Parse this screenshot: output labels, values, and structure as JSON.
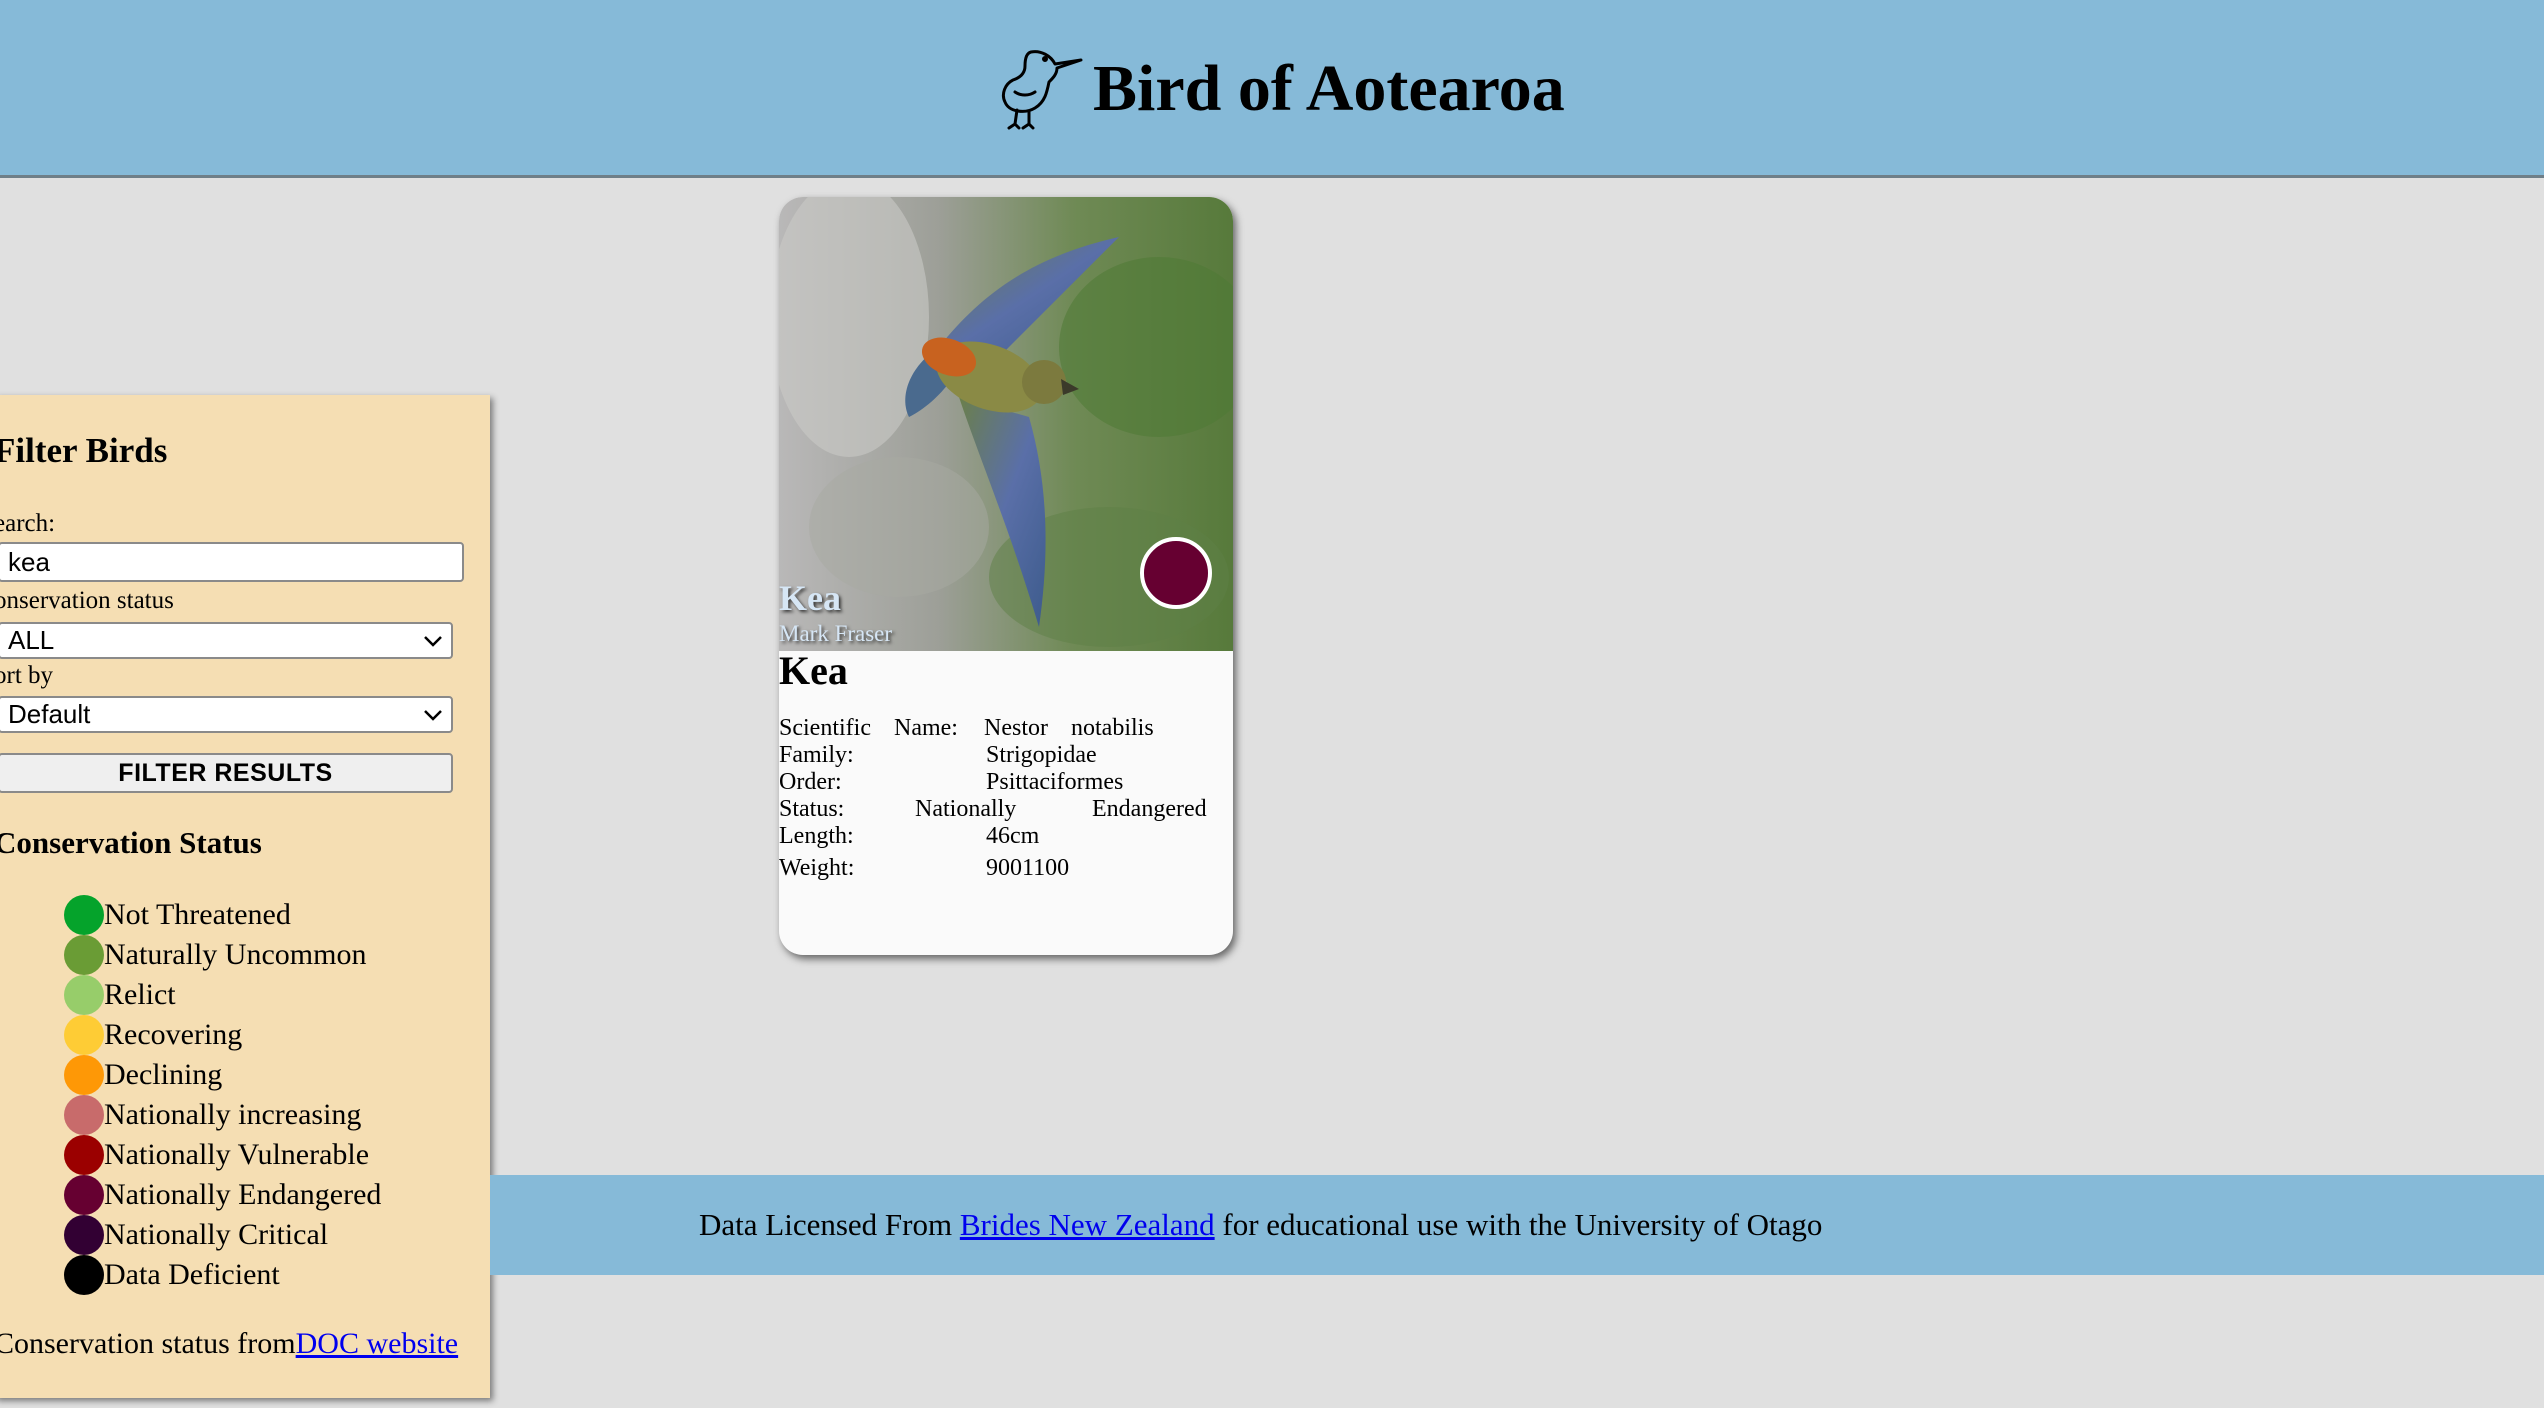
{
  "header": {
    "title": "Bird of Aotearoa",
    "logo_icon": "kiwi-bird-icon"
  },
  "sidebar": {
    "heading": "Filter Birds",
    "search_label": "earch:",
    "search_value": "kea",
    "status_label": "onservation status",
    "status_selected": "ALL",
    "sort_label": "ort by",
    "sort_selected": "Default",
    "filter_button": "FILTER RESULTS",
    "legend_heading": "Conservation Status",
    "legend": [
      {
        "label": "Not Threatened",
        "color": "#05a32b"
      },
      {
        "label": "Naturally Uncommon",
        "color": "#6a9c35"
      },
      {
        "label": "Relict",
        "color": "#97cd6a"
      },
      {
        "label": "Recovering",
        "color": "#fecc35"
      },
      {
        "label": "Declining",
        "color": "#fe9806"
      },
      {
        "label": "Nationally increasing",
        "color": "#c86b6b"
      },
      {
        "label": "Nationally Vulnerable",
        "color": "#9b0000"
      },
      {
        "label": "Nationally Endangered",
        "color": "#660031"
      },
      {
        "label": "Nationally Critical",
        "color": "#320033"
      },
      {
        "label": "Data Deficient",
        "color": "#000000"
      }
    ],
    "source_prefix": "Conservation status from",
    "source_link": "DOC website"
  },
  "card": {
    "photo_name": "Kea",
    "photo_credit": "Mark Fraser",
    "status_color": "#660031",
    "title": "Kea",
    "details": {
      "scientific_a": "Scientific",
      "scientific_b": "Name:",
      "scientific_c": "Nestor",
      "scientific_d": "notabilis",
      "family_label": "Family:",
      "family_value": "Strigopidae",
      "order_label": "Order:",
      "order_value": "Psittaciformes",
      "status_label": "Status:",
      "status_a": "Nationally",
      "status_b": "Endangered",
      "length_label": "Length:",
      "length_value": "46cm",
      "weight_label": "Weight:",
      "weight_value": "9001100"
    }
  },
  "footer": {
    "prefix": "Data Licensed From ",
    "link": "Brides New Zealand",
    "suffix": " for educational use with the University of Otago"
  }
}
